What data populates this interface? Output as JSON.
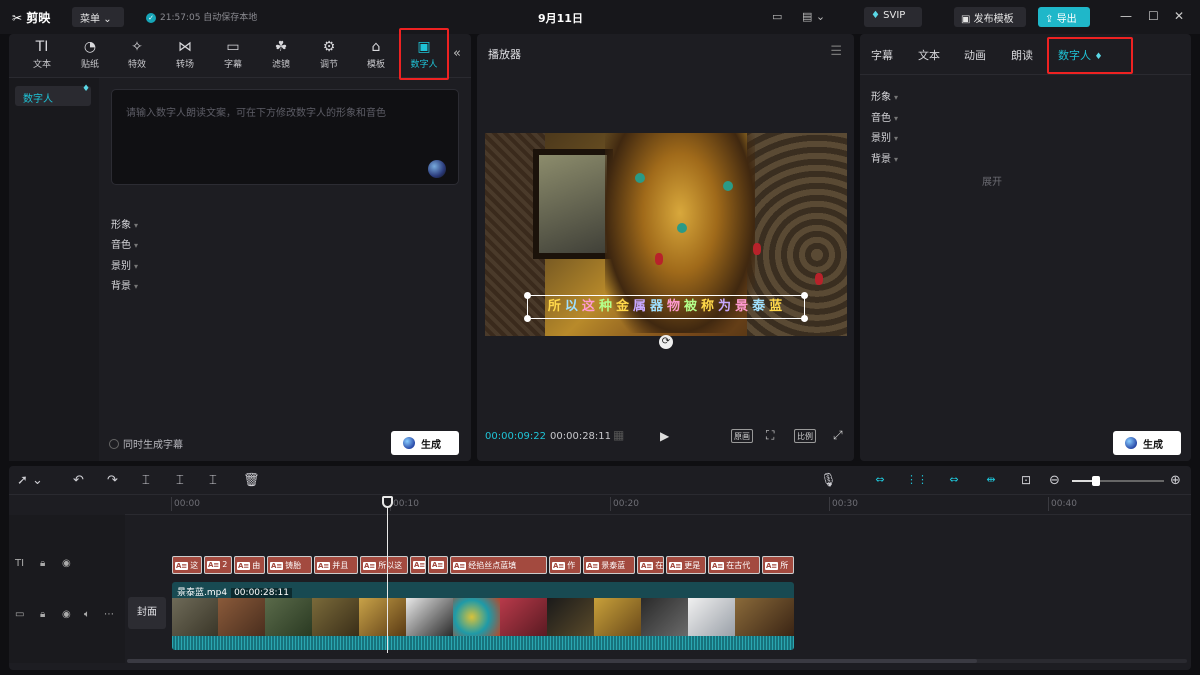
{
  "titlebar": {
    "logo": "剪映",
    "menu_label": "菜单",
    "save_status": "21:57:05 自动保存本地",
    "date": "9月11日",
    "svip_label": "SVIP",
    "publish_label": "发布模板",
    "export_label": "导出"
  },
  "left_panel": {
    "tabs": [
      {
        "label": "文本",
        "icon": "text-icon"
      },
      {
        "label": "贴纸",
        "icon": "sticker-icon"
      },
      {
        "label": "特效",
        "icon": "effects-icon"
      },
      {
        "label": "转场",
        "icon": "transition-icon"
      },
      {
        "label": "字幕",
        "icon": "subtitle-icon"
      },
      {
        "label": "滤镜",
        "icon": "filter-icon"
      },
      {
        "label": "调节",
        "icon": "adjust-icon"
      },
      {
        "label": "模板",
        "icon": "template-icon"
      },
      {
        "label": "数字人",
        "icon": "digital-human-icon",
        "active": true
      }
    ],
    "side_item": "数字人",
    "textarea_placeholder": "请输入数字人朗读文案，可在下方修改数字人的形象和音色",
    "props": [
      "形象",
      "音色",
      "景别",
      "背景"
    ],
    "checkbox_label": "同时生成字幕",
    "generate_label": "生成"
  },
  "player": {
    "title": "播放器",
    "caption_chars": [
      {
        "c": "所",
        "color": "#ffd84a"
      },
      {
        "c": "以",
        "color": "#9fe0ff"
      },
      {
        "c": "这",
        "color": "#ff9ad1"
      },
      {
        "c": "种",
        "color": "#b4ff8a"
      },
      {
        "c": "金",
        "color": "#ffd84a"
      },
      {
        "c": "属",
        "color": "#c7a8ff"
      },
      {
        "c": "器",
        "color": "#9fe0ff"
      },
      {
        "c": "物",
        "color": "#ff9ad1"
      },
      {
        "c": "被",
        "color": "#b4ff8a"
      },
      {
        "c": "称",
        "color": "#ffd84a"
      },
      {
        "c": "为",
        "color": "#c7a8ff"
      },
      {
        "c": "景",
        "color": "#ff9ad1"
      },
      {
        "c": "泰",
        "color": "#9fe0ff"
      },
      {
        "c": "蓝",
        "color": "#ffd84a"
      }
    ],
    "current_time": "00:00:09:22",
    "total_time": "00:00:28:11",
    "original_label": "原画",
    "ratio_label": "比例"
  },
  "right_panel": {
    "tabs": [
      {
        "label": "字幕"
      },
      {
        "label": "文本"
      },
      {
        "label": "动画"
      },
      {
        "label": "朗读"
      },
      {
        "label": "数字人",
        "active": true
      }
    ],
    "props": [
      "形象",
      "音色",
      "景别",
      "背景"
    ],
    "expand_label": "展开",
    "generate_label": "生成"
  },
  "timeline": {
    "ruler_labels": [
      "00:00",
      "00:10",
      "00:20",
      "00:30",
      "00:40"
    ],
    "text_clips": [
      {
        "label": "这"
      },
      {
        "label": "2"
      },
      {
        "label": "由"
      },
      {
        "label": "铸胎"
      },
      {
        "label": "并且"
      },
      {
        "label": "所以这"
      },
      {
        "label": ""
      },
      {
        "label": ""
      },
      {
        "label": "经掐丝点蓝填"
      },
      {
        "label": "作"
      },
      {
        "label": "景泰蓝"
      },
      {
        "label": "在"
      },
      {
        "label": "更是"
      },
      {
        "label": "在古代"
      },
      {
        "label": "所"
      }
    ],
    "cover_label": "封面",
    "video_clip_name": "景泰蓝.mp4",
    "video_clip_duration": "00:00:28:11"
  },
  "colors": {
    "accent": "#1fc3d6",
    "highlight": "#e22222",
    "text_clip": "#a34a3f",
    "video_clip": "#184a52"
  }
}
